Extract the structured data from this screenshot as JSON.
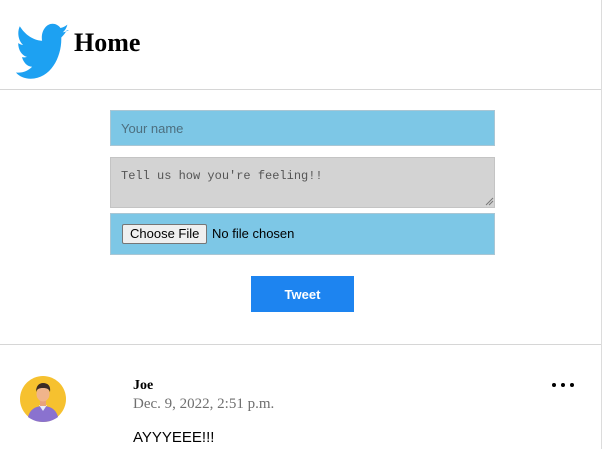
{
  "header": {
    "title": "Home",
    "logo_icon": "twitter-bird-icon",
    "brand_color": "#1da1f2"
  },
  "composer": {
    "name_placeholder": "Your name",
    "name_value": "",
    "feeling_placeholder": "Tell us how you're feeling!!",
    "feeling_value": "",
    "file_button_label": "Choose File",
    "file_status": "No file chosen",
    "tweet_button_label": "Tweet",
    "input_color": "#7dc7e6",
    "textarea_color": "#d3d3d3",
    "button_color": "#1d84f0"
  },
  "tweets": [
    {
      "author": "Joe",
      "timestamp": "Dec. 9, 2022, 2:51 p.m.",
      "text": "AYYYEEE!!!",
      "avatar_icon": "user-avatar-icon",
      "menu_icon": "more-options-icon"
    }
  ]
}
